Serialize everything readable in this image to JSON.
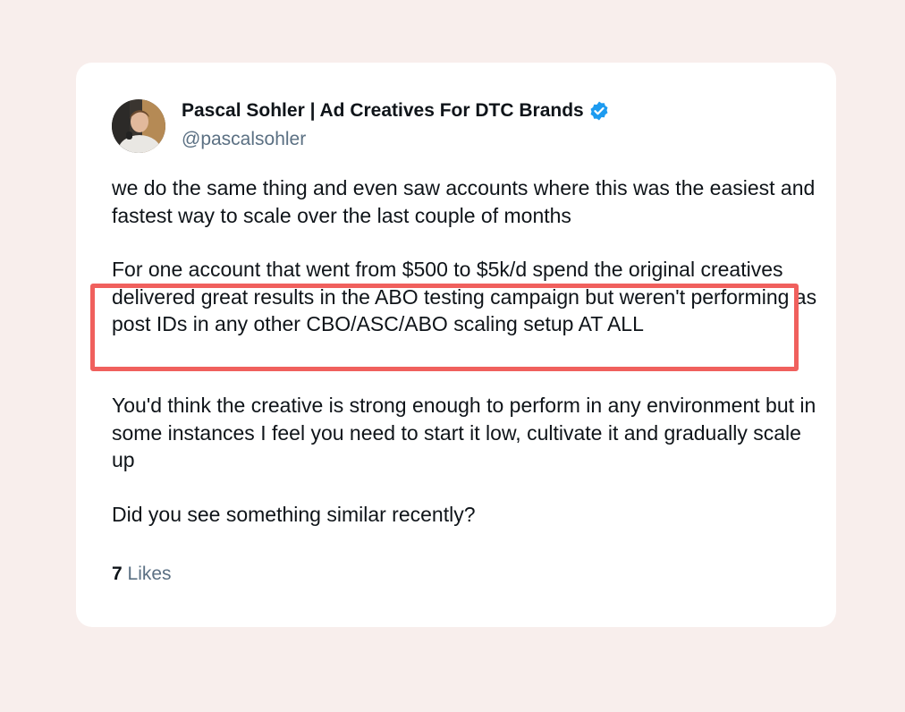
{
  "author": {
    "name": "Pascal Sohler | Ad Creatives For DTC Brands",
    "handle": "@pascalsohler",
    "avatar_icon": "profile-photo",
    "verified_icon": "verified-badge-icon",
    "verified_color": "#1d9bf0"
  },
  "post": {
    "paragraphs": [
      "we do the same thing and even saw accounts where this was the easiest and fastest way to scale over the last couple of months",
      "For one account that went from $500 to $5k/d spend the original creatives delivered great results in the ABO testing campaign but weren't performing as post IDs in any other CBO/ASC/ABO scaling setup AT ALL",
      "You'd think the creative is strong enough to perform in any environment but in some instances I feel you need to start it low, cultivate it and gradually scale up",
      "Did you see something similar recently?"
    ]
  },
  "stats": {
    "likes_count": "7",
    "likes_label": "Likes"
  },
  "colors": {
    "background": "#f8eeec",
    "highlight": "#f0605d"
  }
}
